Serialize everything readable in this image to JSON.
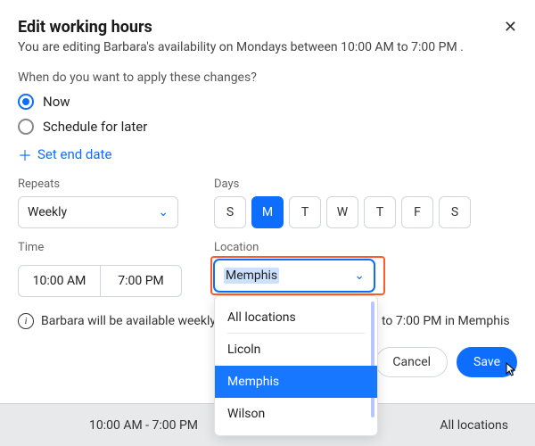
{
  "header": {
    "title": "Edit working hours",
    "subtitle": "You are editing Barbara's availability on Mondays between 10:00 AM to 7:00 PM ."
  },
  "apply": {
    "question": "When do you want to apply these changes?",
    "now": "Now",
    "later": "Schedule for later",
    "set_end": "Set end date"
  },
  "repeats": {
    "label": "Repeats",
    "value": "Weekly"
  },
  "days": {
    "label": "Days",
    "items": [
      "S",
      "M",
      "T",
      "W",
      "T",
      "F",
      "S"
    ],
    "active_index": 1
  },
  "time": {
    "label": "Time",
    "start": "10:00 AM",
    "end": "7:00 PM"
  },
  "location": {
    "label": "Location",
    "value": "Memphis",
    "options": [
      "All locations",
      "Licoln",
      "Memphis",
      "Wilson"
    ]
  },
  "info": {
    "prefix": "Barbara will be available weekly",
    "suffix": "to 7:00 PM in Memphis"
  },
  "actions": {
    "cancel": "Cancel",
    "save": "Save"
  },
  "footer": {
    "time_range": "10:00 AM - 7:00 PM",
    "location": "All locations"
  }
}
